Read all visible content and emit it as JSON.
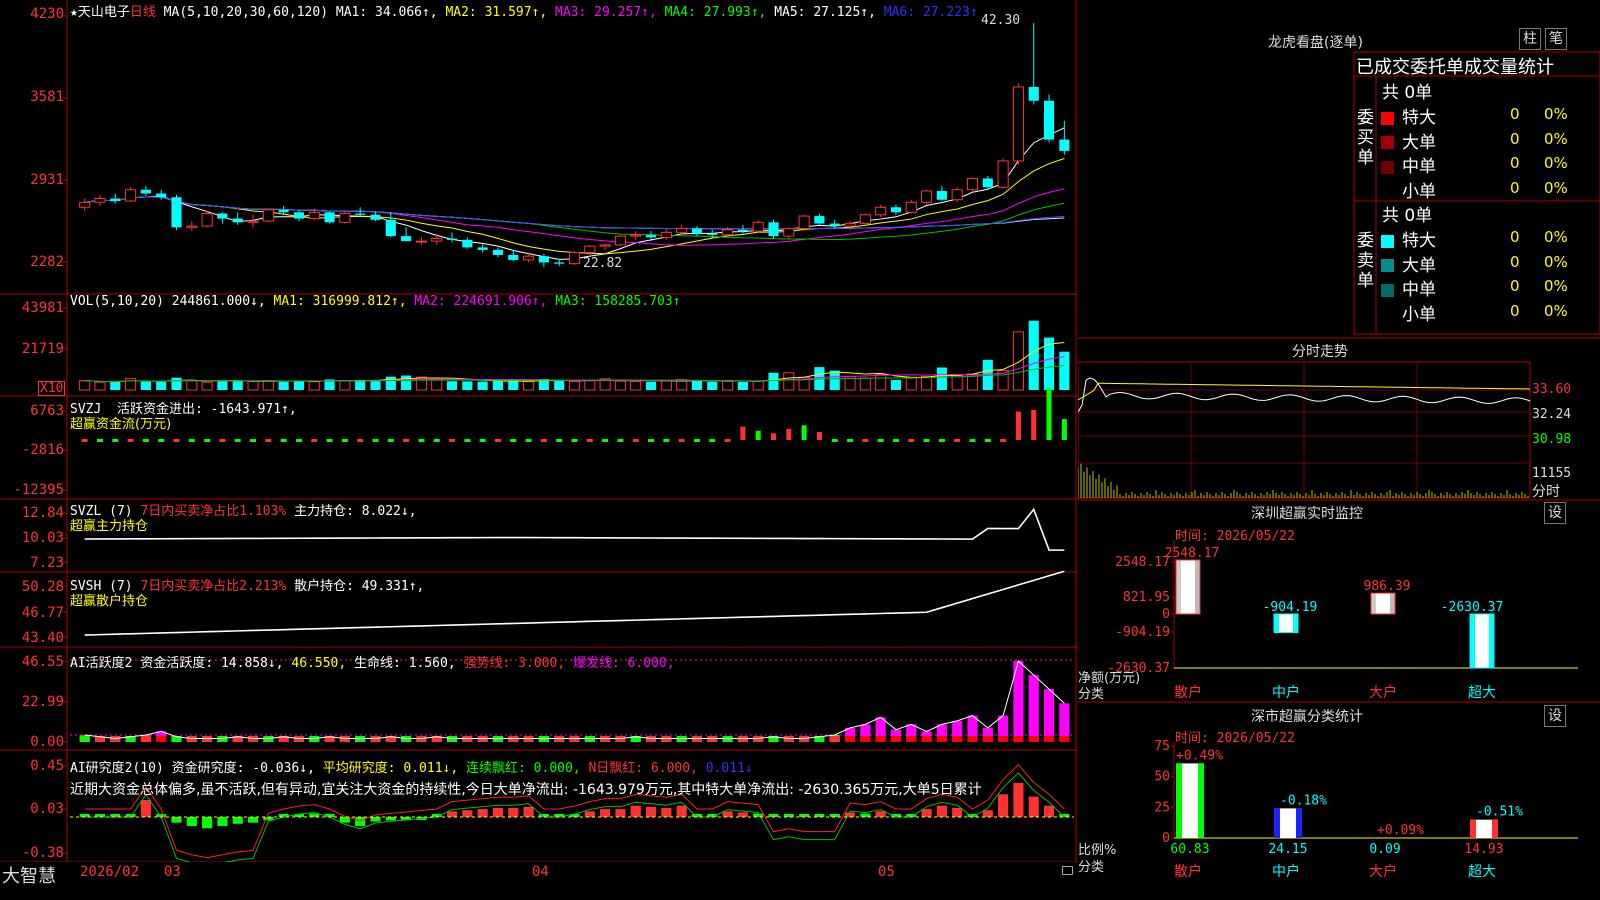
{
  "stock": {
    "name": "★天山电子",
    "period": "日线"
  },
  "ma_line": {
    "params": "MA(5,10,20,30,60,120)",
    "ma1": "MA1: 34.066↑,",
    "ma2": "MA2: 31.597↑,",
    "ma3": "MA3: 29.257↑,",
    "ma4": "MA4: 27.993↑,",
    "ma5": "MA5: 27.125↑,",
    "ma6": "MA6: 27.223↑"
  },
  "price_axis": [
    "4230",
    "3581",
    "2931",
    "2282"
  ],
  "price_annot": {
    "high": "42.30",
    "low": "22.82"
  },
  "vol": {
    "params": "VOL(5,10,20)",
    "value": "244861.000↓,",
    "ma1": "MA1: 316999.812↑,",
    "ma2": "MA2: 224691.906↑,",
    "ma3": "MA3: 158285.703↑",
    "axis": [
      "43981",
      "21719"
    ],
    "unit": "X10"
  },
  "svzj": {
    "label": "SVZJ",
    "text": "活跃资金进出: -1643.971↑,",
    "sub": "超赢资金流(万元)",
    "axis": [
      "6763",
      "-2816",
      "-12395"
    ]
  },
  "svzl": {
    "label": "SVZL (7)",
    "ratio": "7日内买卖净占比1.103%",
    "hold": "主力持仓: 8.022↓,",
    "sub": "超赢主力持仓",
    "axis": [
      "12.84",
      "10.03",
      "7.23"
    ]
  },
  "svsh": {
    "label": "SVSH (7)",
    "ratio": "7日内买卖净占比2.213%",
    "hold": "散户持仓: 49.331↑,",
    "sub": "超赢散户持仓",
    "axis": [
      "50.28",
      "46.77",
      "43.40"
    ]
  },
  "ai_active": {
    "label": "AI活跃度2",
    "a": "资金活跃度: 14.858↓,",
    "b": "46.550,",
    "c": "生命线: 1.560,",
    "d": "强势线: 3.000,",
    "e": "爆发线: 6.000,",
    "axis": [
      "46.55",
      "22.99",
      "0.00"
    ]
  },
  "ai_research": {
    "label": "AI研究度2(10)",
    "a": "资金研究度: -0.036↓,",
    "b": "平均研究度: 0.011↓,",
    "c": "连续飘红: 0.000,",
    "d": "N日飘红: 6.000,",
    "e": "0.011↓",
    "comment": "近期大资金总体偏多,虽不活跃,但有异动,宜关注大资金的持续性,今日大单净流出: -1643.979万元,其中特大单净流出: -2630.365万元,大单5日累计",
    "axis": [
      "0.45",
      "0.03",
      "-0.38"
    ]
  },
  "bottom": {
    "brand": "大智慧",
    "dates": [
      "2026/02",
      "03",
      "04",
      "05"
    ]
  },
  "longhu": {
    "title": "龙虎看盘(逐单)",
    "btn_zhu": "柱",
    "btn_bi": "笔",
    "header": "已成交委托单成交量统计",
    "buy": {
      "vertical": "委买单",
      "count": "共 0单",
      "rows": [
        {
          "label": "特大",
          "v": "0",
          "p": "0%",
          "color": "#ff0000"
        },
        {
          "label": "大单",
          "v": "0",
          "p": "0%",
          "color": "#a00000"
        },
        {
          "label": "中单",
          "v": "0",
          "p": "0%",
          "color": "#700000"
        },
        {
          "label": "小单",
          "v": "0",
          "p": "0%",
          "color": ""
        }
      ]
    },
    "sell": {
      "vertical": "委卖单",
      "count": "共 0单",
      "rows": [
        {
          "label": "特大",
          "v": "0",
          "p": "0%",
          "color": "#00ffff"
        },
        {
          "label": "大单",
          "v": "0",
          "p": "0%",
          "color": "#008f8f"
        },
        {
          "label": "中单",
          "v": "0",
          "p": "0%",
          "color": "#006b6b"
        },
        {
          "label": "小单",
          "v": "0",
          "p": "0%",
          "color": ""
        }
      ]
    }
  },
  "fenshi": {
    "title": "分时走势",
    "axis": [
      "33.60",
      "32.24",
      "30.98"
    ],
    "vol_axis": "11155",
    "footer": "分时"
  },
  "shenzhen_monitor": {
    "title": "深圳超赢实时监控",
    "btn": "设",
    "time": "时间: 2026/05/22",
    "axis": [
      "2548.17",
      "821.95",
      "0",
      "-904.19",
      "-2630.37"
    ],
    "ylabel": "净额(万元)",
    "xlabel": "分类",
    "bars": [
      {
        "cat": "散户",
        "value": "2548.17"
      },
      {
        "cat": "中户",
        "value": "-904.19"
      },
      {
        "cat": "大户",
        "value": "986.39"
      },
      {
        "cat": "超大",
        "value": "-2630.37"
      }
    ]
  },
  "shenzhen_class": {
    "title": "深市超赢分类统计",
    "btn": "设",
    "time": "时间: 2026/05/22",
    "axis": [
      "75",
      "50",
      "25",
      "0"
    ],
    "ylabel": "比例%",
    "xlabel": "分类",
    "bars": [
      {
        "cat": "散户",
        "value": "60.83",
        "delta": "+0.49%"
      },
      {
        "cat": "中户",
        "value": "24.15",
        "delta": "-0.18%"
      },
      {
        "cat": "大户",
        "value": "0.09",
        "delta": "+0.09%"
      },
      {
        "cat": "超大",
        "value": "14.93",
        "delta": "-0.51%"
      }
    ]
  },
  "chart_data": {
    "type": "candlestick",
    "ohlc": [
      [
        27.6,
        28.3,
        27.3,
        28.0
      ],
      [
        28.0,
        28.6,
        27.7,
        28.3
      ],
      [
        28.3,
        28.7,
        27.9,
        28.1
      ],
      [
        28.1,
        29.2,
        28.0,
        29.0
      ],
      [
        29.0,
        29.3,
        28.5,
        28.7
      ],
      [
        28.7,
        29.0,
        28.2,
        28.4
      ],
      [
        28.4,
        28.6,
        25.8,
        26.0
      ],
      [
        26.0,
        26.5,
        25.7,
        26.1
      ],
      [
        26.1,
        27.3,
        26.0,
        27.1
      ],
      [
        27.1,
        27.2,
        26.3,
        26.7
      ],
      [
        26.7,
        27.2,
        26.2,
        26.4
      ],
      [
        26.4,
        27.0,
        26.0,
        26.5
      ],
      [
        26.5,
        27.5,
        26.4,
        27.4
      ],
      [
        27.4,
        27.7,
        27.0,
        27.2
      ],
      [
        27.2,
        27.4,
        26.5,
        26.7
      ],
      [
        26.7,
        27.5,
        26.6,
        27.2
      ],
      [
        27.2,
        27.3,
        26.3,
        26.4
      ],
      [
        26.4,
        27.3,
        26.3,
        27.1
      ],
      [
        27.1,
        27.6,
        26.8,
        27.0
      ],
      [
        27.0,
        27.2,
        26.5,
        26.6
      ],
      [
        26.6,
        27.2,
        25.2,
        25.3
      ],
      [
        25.3,
        26.0,
        24.9,
        24.9
      ],
      [
        24.9,
        25.2,
        24.6,
        24.9
      ],
      [
        24.9,
        25.5,
        24.6,
        25.1
      ],
      [
        25.1,
        25.6,
        24.8,
        25.0
      ],
      [
        25.0,
        25.2,
        24.3,
        24.4
      ],
      [
        24.4,
        24.7,
        24.0,
        24.2
      ],
      [
        24.2,
        24.4,
        23.6,
        23.8
      ],
      [
        23.8,
        24.2,
        23.3,
        23.4
      ],
      [
        23.4,
        24.0,
        23.2,
        23.7
      ],
      [
        23.7,
        23.9,
        22.82,
        23.2
      ],
      [
        23.2,
        23.5,
        22.9,
        23.1
      ],
      [
        23.1,
        24.1,
        23.0,
        24.0
      ],
      [
        24.0,
        24.6,
        23.8,
        24.5
      ],
      [
        24.5,
        24.7,
        24.2,
        24.6
      ],
      [
        24.6,
        25.4,
        24.5,
        25.3
      ],
      [
        25.3,
        25.7,
        25.0,
        25.4
      ],
      [
        25.4,
        25.7,
        24.9,
        25.2
      ],
      [
        25.2,
        25.9,
        25.0,
        25.6
      ],
      [
        25.6,
        26.2,
        25.4,
        25.9
      ],
      [
        25.9,
        26.1,
        25.3,
        25.5
      ],
      [
        25.5,
        25.8,
        25.1,
        25.4
      ],
      [
        25.4,
        26.0,
        25.2,
        25.8
      ],
      [
        25.8,
        26.2,
        25.5,
        25.7
      ],
      [
        25.7,
        26.6,
        25.6,
        26.4
      ],
      [
        26.4,
        26.6,
        25.1,
        25.3
      ],
      [
        25.3,
        26.0,
        25.1,
        25.9
      ],
      [
        25.9,
        27.0,
        25.7,
        26.9
      ],
      [
        26.9,
        27.1,
        26.2,
        26.3
      ],
      [
        26.3,
        26.6,
        25.9,
        26.1
      ],
      [
        26.1,
        26.5,
        25.8,
        26.3
      ],
      [
        26.3,
        27.1,
        26.2,
        27.0
      ],
      [
        27.0,
        27.8,
        26.8,
        27.6
      ],
      [
        27.6,
        27.8,
        27.0,
        27.2
      ],
      [
        27.2,
        28.2,
        27.1,
        28.0
      ],
      [
        28.0,
        29.0,
        27.8,
        28.9
      ],
      [
        28.9,
        29.3,
        28.1,
        28.2
      ],
      [
        28.2,
        29.2,
        28.0,
        29.0
      ],
      [
        29.0,
        30.0,
        28.8,
        29.9
      ],
      [
        29.9,
        30.1,
        29.0,
        29.2
      ],
      [
        29.2,
        31.5,
        29.1,
        31.3
      ],
      [
        31.3,
        37.5,
        31.0,
        37.2
      ],
      [
        37.2,
        42.3,
        35.8,
        36.1
      ],
      [
        36.1,
        36.6,
        32.8,
        33.0
      ],
      [
        33.0,
        34.5,
        31.8,
        32.1
      ]
    ],
    "price_range": [
      21.0,
      43.5
    ],
    "volume": [
      4800,
      4000,
      4100,
      5800,
      4300,
      4200,
      6300,
      4600,
      4000,
      4400,
      4700,
      4500,
      4800,
      4200,
      4700,
      4200,
      5400,
      4700,
      5100,
      4800,
      6800,
      7400,
      6600,
      5100,
      4500,
      4400,
      4300,
      4600,
      5000,
      4300,
      5600,
      4700,
      4300,
      5000,
      5700,
      4500,
      4400,
      4200,
      4600,
      5300,
      5000,
      4200,
      4400,
      4100,
      4500,
      8800,
      8800,
      6500,
      11700,
      9900,
      6800,
      6100,
      8000,
      5100,
      6300,
      6900,
      11500,
      7500,
      8200,
      15400,
      9900,
      29700,
      35400,
      26800,
      19600
    ],
    "vol_max": 46000,
    "ai_active": [
      4,
      3,
      2,
      3,
      4,
      6,
      3,
      2,
      2,
      2,
      3,
      2,
      2,
      3,
      2,
      2,
      3,
      2,
      2,
      2,
      3,
      2,
      2,
      3,
      2,
      2,
      2,
      2,
      2,
      2,
      2,
      2,
      2,
      2,
      2,
      2,
      3,
      2,
      2,
      2,
      2,
      2,
      2,
      2,
      2,
      3,
      2,
      2,
      3,
      4,
      8,
      10,
      14,
      7,
      10,
      6,
      10,
      12,
      15,
      8,
      15,
      46,
      38,
      30,
      22
    ],
    "ai_research": [
      0.0,
      0.0,
      0.0,
      0.0,
      0.15,
      0.0,
      -0.05,
      -0.08,
      -0.1,
      -0.08,
      -0.06,
      -0.05,
      -0.03,
      0.0,
      0.02,
      0.03,
      0.0,
      -0.05,
      -0.08,
      -0.04,
      -0.03,
      -0.02,
      -0.01,
      0.0,
      0.05,
      0.06,
      0.07,
      0.08,
      0.08,
      0.09,
      0.0,
      0.0,
      0.02,
      0.05,
      0.07,
      0.07,
      0.1,
      0.09,
      0.08,
      0.1,
      0.0,
      0.0,
      0.05,
      0.04,
      0.03,
      0.0,
      0.02,
      0.0,
      0.0,
      0.0,
      0.04,
      0.03,
      0.05,
      0.0,
      0.0,
      0.07,
      0.1,
      0.08,
      0.0,
      0.06,
      0.2,
      0.3,
      0.18,
      0.1,
      0.0
    ],
    "zjl": [
      0,
      0,
      0,
      0,
      0,
      0,
      0,
      0,
      0,
      0,
      0,
      0,
      0,
      0,
      0,
      0,
      0,
      0,
      0,
      0,
      0,
      0,
      0,
      0,
      0,
      0,
      0,
      0,
      0,
      0,
      0,
      0,
      0,
      0,
      0,
      0,
      0,
      0,
      0,
      0,
      0,
      0,
      0,
      3000,
      -2200,
      1500,
      2500,
      -3500,
      1800,
      0,
      0,
      0,
      0,
      0,
      0,
      0,
      0,
      0,
      0,
      0,
      0,
      6400,
      6763,
      -12395,
      -5000,
      -1643
    ]
  }
}
